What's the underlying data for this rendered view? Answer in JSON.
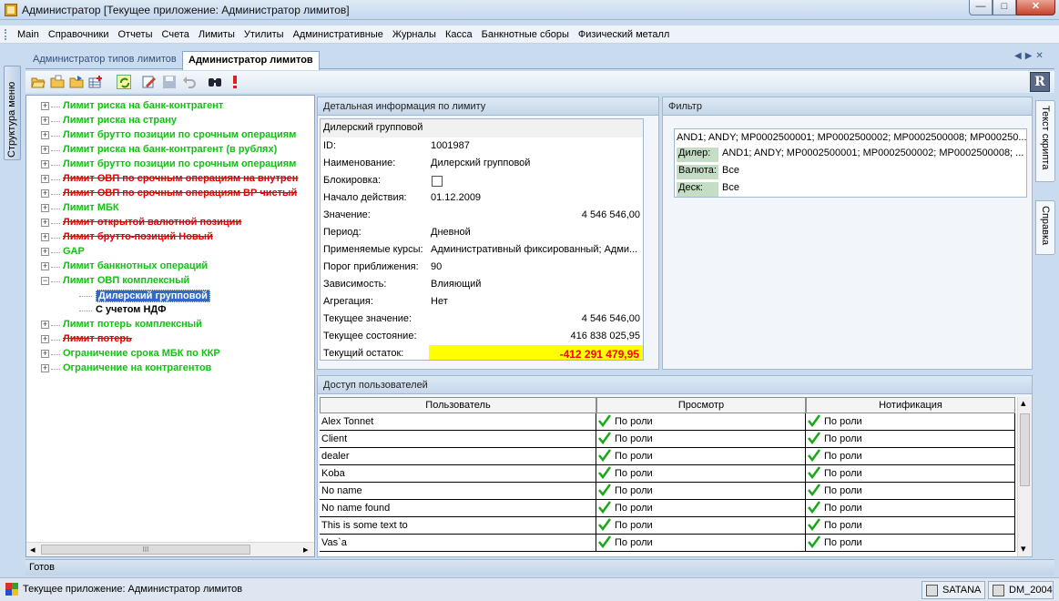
{
  "window": {
    "title": "Администратор [Текущее приложение: Администратор лимитов]",
    "minimize_label": "—",
    "maximize_label": "□",
    "close_label": "✕"
  },
  "menu": [
    "Main",
    "Справочники",
    "Отчеты",
    "Счета",
    "Лимиты",
    "Утилиты",
    "Административные",
    "Журналы",
    "Касса",
    "Банкнотные сборы",
    "Физический металл"
  ],
  "left_strip": {
    "label": "Структура меню"
  },
  "right_strip": {
    "script_text": "Текст скрипта",
    "help": "Справка"
  },
  "tabs": [
    {
      "label": "Администратор типов лимитов",
      "active": false
    },
    {
      "label": "Администратор лимитов",
      "active": true
    }
  ],
  "tab_nav": {
    "prev": "◀",
    "next": "▶",
    "close": "✕"
  },
  "toolbar": {
    "icons": [
      "open-folder-icon",
      "folder-icon",
      "folder-arrow-icon",
      "grid-add-icon",
      "refresh-icon",
      "edit-icon",
      "save-icon",
      "undo-icon",
      "find-icon",
      "alert-icon"
    ],
    "r_label": "R"
  },
  "tree": {
    "items": [
      {
        "label": "Лимит риска на банк-контрагент",
        "status": "active",
        "expander": "+"
      },
      {
        "label": "Лимит риска на страну",
        "status": "active",
        "expander": "+"
      },
      {
        "label": "Лимит брутто позиции по срочным операциям",
        "status": "active",
        "expander": "+"
      },
      {
        "label": "Лимит риска на банк-контрагент (в рублях)",
        "status": "active",
        "expander": "+"
      },
      {
        "label": "Лимит брутто позиции по срочным операциям",
        "status": "active",
        "expander": "+"
      },
      {
        "label": "Лимит ОВП по срочным операциям на внутрен",
        "status": "blocked",
        "expander": "+"
      },
      {
        "label": "Лимит ОВП по срочным операциям ВР чистый",
        "status": "blocked",
        "expander": "+"
      },
      {
        "label": "Лимит МБК",
        "status": "active",
        "expander": "+"
      },
      {
        "label": "Лимит открытой валютной позиции",
        "status": "blocked",
        "expander": "+"
      },
      {
        "label": "Лимит брутто-позиций Новый",
        "status": "blocked",
        "expander": "+"
      },
      {
        "label": "GAP",
        "status": "active",
        "expander": "+"
      },
      {
        "label": "Лимит банкнотных операций",
        "status": "active",
        "expander": "+"
      },
      {
        "label": "Лимит ОВП комплексный",
        "status": "active",
        "expander": "−"
      },
      {
        "label": "Дилерский групповой",
        "status": "selected",
        "expander": ""
      },
      {
        "label": "С учетом НДФ",
        "status": "child",
        "expander": ""
      },
      {
        "label": "Лимит потерь комплексный",
        "status": "active",
        "expander": "+"
      },
      {
        "label": "Лимит потерь",
        "status": "blocked",
        "expander": "+"
      },
      {
        "label": "Ограничение срока МБК по ККР",
        "status": "active",
        "expander": "+"
      },
      {
        "label": "Ограничение на контрагентов",
        "status": "active",
        "expander": "+"
      }
    ],
    "hscroll": {
      "left": "◂",
      "thumb": "III",
      "right": "▸"
    }
  },
  "detail": {
    "header": "Детальная информация по лимиту",
    "top_label": "Дилерский групповой",
    "rows": [
      {
        "label": "ID:",
        "value": "1001987",
        "type": "text"
      },
      {
        "label": "Наименование:",
        "value": "Дилерский групповой",
        "type": "text"
      },
      {
        "label": "Блокировка:",
        "value": "",
        "type": "checkbox"
      },
      {
        "label": "Начало действия:",
        "value": "01.12.2009",
        "type": "text"
      },
      {
        "label": "Значение:",
        "value": "4 546 546,00",
        "type": "num"
      },
      {
        "label": "Период:",
        "value": "Дневной",
        "type": "text"
      },
      {
        "label": "Применяемые курсы:",
        "value": "Административный фиксированный; Адми...",
        "type": "text"
      },
      {
        "label": "Порог приближения:",
        "value": "90",
        "type": "text"
      },
      {
        "label": "Зависимость:",
        "value": "Влияющий",
        "type": "text"
      },
      {
        "label": "Агрегация:",
        "value": "Нет",
        "type": "text"
      },
      {
        "label": "Текущее значение:",
        "value": "4 546 546,00",
        "type": "num"
      },
      {
        "label": "Текущее состояние:",
        "value": "416 838 025,95",
        "type": "num"
      },
      {
        "label": "Текущий остаток:",
        "value": "-412 291 479,95",
        "type": "alert"
      }
    ],
    "alert_colors": {
      "bg": "#ffff00",
      "fg": "#ff0000"
    }
  },
  "filter": {
    "header": "Фильтр",
    "summary": "AND1; ANDY; MP0002500001; MP0002500002; MP0002500008; MP000250...",
    "rows": [
      {
        "label": "Дилер:",
        "value": "AND1; ANDY; MP0002500001; MP0002500002; MP0002500008; ..."
      },
      {
        "label": "Валюта:",
        "value": "Все"
      },
      {
        "label": "Деск:",
        "value": "Все"
      }
    ]
  },
  "access": {
    "header": "Доступ пользователей",
    "columns": [
      "Пользователь",
      "Просмотр",
      "Нотификация"
    ],
    "rows": [
      {
        "user": "Alex Tonnet",
        "view": "По роли",
        "notify": "По роли"
      },
      {
        "user": "Client",
        "view": "По роли",
        "notify": "По роли"
      },
      {
        "user": "dealer",
        "view": "По роли",
        "notify": "По роли"
      },
      {
        "user": "Koba",
        "view": "По роли",
        "notify": "По роли"
      },
      {
        "user": "No name",
        "view": "По роли",
        "notify": "По роли"
      },
      {
        "user": "No name found",
        "view": "По роли",
        "notify": "По роли"
      },
      {
        "user": "This is some text to",
        "view": "По роли",
        "notify": "По роли"
      },
      {
        "user": "Vas`a",
        "view": "По роли",
        "notify": "По роли"
      }
    ],
    "vscroll": {
      "up": "▴",
      "down": "▾"
    }
  },
  "status": {
    "ready": "Готов",
    "app": "Текущее приложение: Администратор лимитов",
    "server": "SATANA",
    "db": "DM_2004"
  }
}
